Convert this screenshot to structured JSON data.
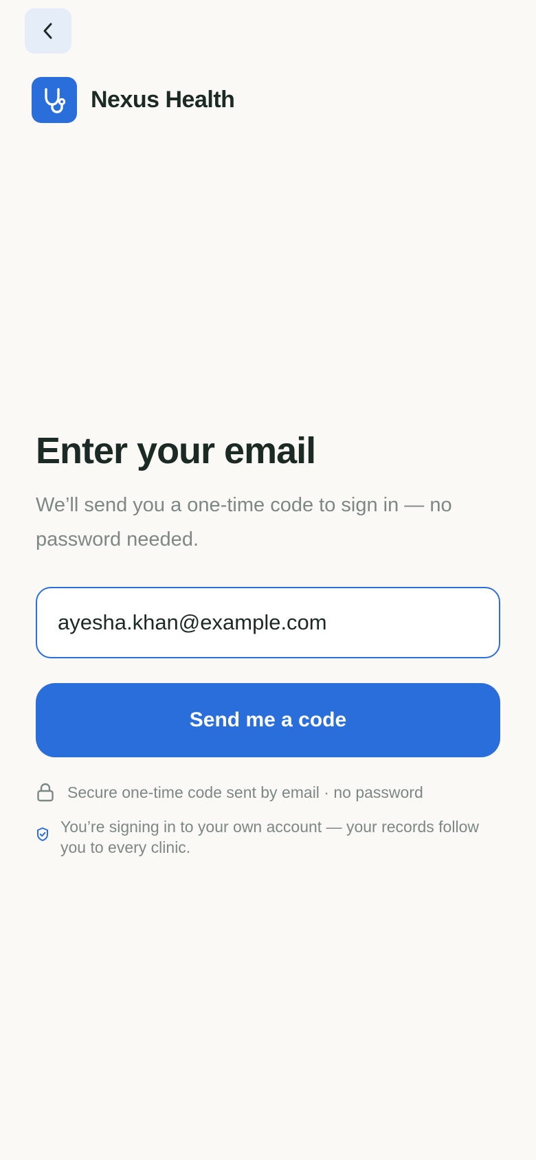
{
  "header": {
    "back_icon": "chevron-left-icon",
    "brand": {
      "logo_icon": "stethoscope-icon",
      "name": "Nexus Health"
    }
  },
  "main": {
    "title": "Enter your email",
    "subtitle": "We’ll send you a one-time code to sign in — no password needed.",
    "email_input": {
      "value": "ayesha.khan@example.com",
      "placeholder": ""
    },
    "send_button_label": "Send me a code",
    "notes": [
      {
        "icon": "lock-icon",
        "text": "Secure one-time code sent by email · no password"
      },
      {
        "icon": "shield-check-icon",
        "text": "You’re signing in to your own account — your records follow you to every clinic."
      }
    ]
  },
  "colors": {
    "accent": "#2a6edb",
    "background": "#faf9f5",
    "text_primary": "#1c2a26",
    "text_muted": "#7d8884",
    "back_button_bg": "#e5edf8"
  }
}
